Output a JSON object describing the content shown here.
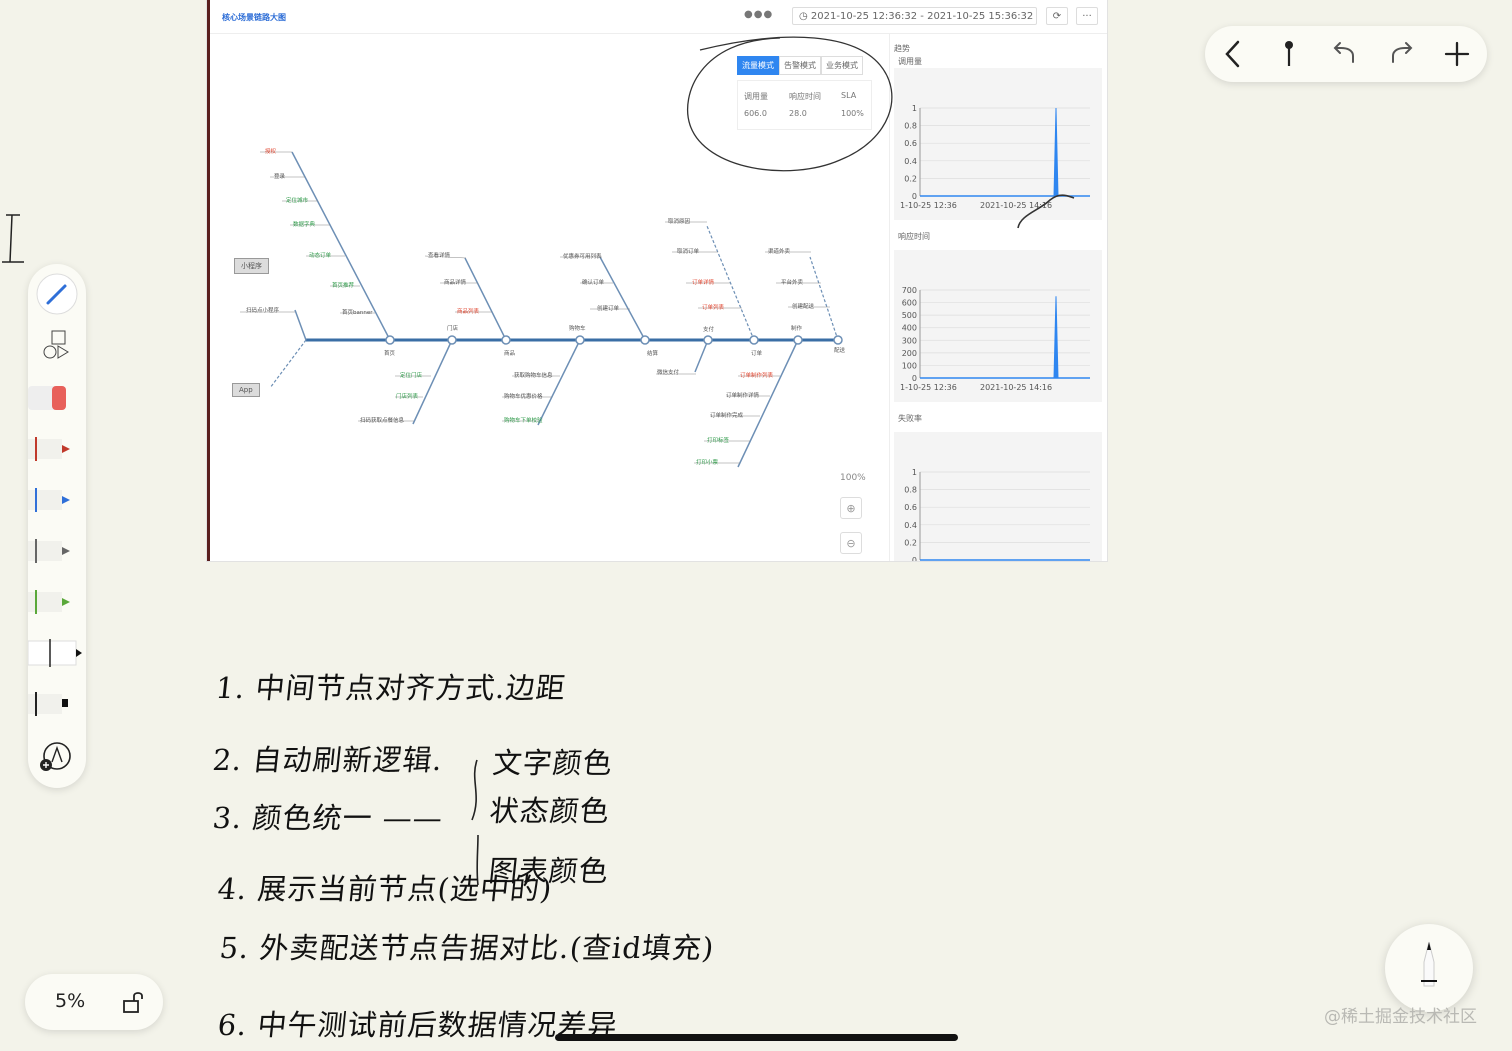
{
  "dashboard": {
    "title": "核心场景链路大图",
    "date_range": "2021-10-25 12:36:32 - 2021-10-25 15:36:32",
    "refresh_icon": "refresh-icon",
    "more_icon": "more-icon",
    "modes": [
      "流量模式",
      "告警模式",
      "业务模式"
    ],
    "active_mode": "流量模式",
    "metrics": {
      "headers": [
        "调用量",
        "响应时间",
        "SLA"
      ],
      "values": [
        "606.0",
        "28.0",
        "100%"
      ]
    },
    "entries": [
      "小程序",
      "App"
    ],
    "spine_nodes": [
      "首页",
      "门店",
      "商品",
      "购物车",
      "结算",
      "支付",
      "订单",
      "制作",
      "配送"
    ],
    "upper_branches": [
      {
        "node": "首页",
        "items": [
          {
            "text": "授权",
            "color": "red"
          },
          {
            "text": "登录",
            "color": "gray"
          },
          {
            "text": "定位城市",
            "color": "green"
          },
          {
            "text": "数据字典",
            "color": "green"
          },
          {
            "text": "动态订单",
            "color": "green"
          },
          {
            "text": "首页推荐",
            "color": "green"
          },
          {
            "text": "首页banner",
            "color": "gray"
          }
        ]
      },
      {
        "node": "商品",
        "items": [
          {
            "text": "查看详情",
            "color": "gray"
          },
          {
            "text": "商品详情",
            "color": "gray"
          },
          {
            "text": "商品列表",
            "color": "red"
          }
        ]
      },
      {
        "node": "结算",
        "items": [
          {
            "text": "优惠券可用列表",
            "color": "gray"
          },
          {
            "text": "确认订单",
            "color": "gray"
          },
          {
            "text": "创建订单",
            "color": "gray"
          }
        ]
      },
      {
        "node": "订单",
        "items": [
          {
            "text": "取消原因",
            "color": "gray"
          },
          {
            "text": "取消订单",
            "color": "gray"
          },
          {
            "text": "订单详情",
            "color": "red"
          },
          {
            "text": "订单列表",
            "color": "red"
          }
        ]
      },
      {
        "node": "配送",
        "items": [
          {
            "text": "渠道外卖",
            "color": "gray"
          },
          {
            "text": "平台外卖",
            "color": "gray"
          },
          {
            "text": "创建配送",
            "color": "gray"
          }
        ]
      }
    ],
    "lower_branches": [
      {
        "node": "门店",
        "items": [
          {
            "text": "定位门店",
            "color": "green"
          },
          {
            "text": "门店列表",
            "color": "green"
          },
          {
            "text": "扫码获取点餐信息",
            "color": "gray"
          }
        ]
      },
      {
        "node": "购物车",
        "items": [
          {
            "text": "获取购物车信息",
            "color": "gray"
          },
          {
            "text": "购物车优惠价格",
            "color": "gray"
          },
          {
            "text": "购物车下单校验",
            "color": "green"
          }
        ]
      },
      {
        "node": "支付",
        "items": [
          {
            "text": "微信支付",
            "color": "gray"
          }
        ]
      },
      {
        "node": "制作",
        "items": [
          {
            "text": "订单制作列表",
            "color": "red"
          },
          {
            "text": "订单制作详情",
            "color": "gray"
          },
          {
            "text": "订单制作完成",
            "color": "gray"
          },
          {
            "text": "打印标签",
            "color": "green"
          },
          {
            "text": "打印小票",
            "color": "green"
          }
        ]
      }
    ],
    "entry_branch_label": "扫码点小程序",
    "zoom": "100%",
    "side": {
      "section": "趋势",
      "charts": [
        {
          "label": "调用量",
          "yticks": [
            "1",
            "0.8",
            "0.6",
            "0.4",
            "0.2",
            "0"
          ],
          "xticks": [
            "1-10-25 12:36",
            "2021-10-25 14:16"
          ],
          "spike": true,
          "spike_value": 1
        },
        {
          "label": "响应时间",
          "yticks": [
            "700",
            "600",
            "500",
            "400",
            "300",
            "200",
            "100",
            "0"
          ],
          "xticks": [
            "1-10-25 12:36",
            "2021-10-25 14:16"
          ],
          "spike": true,
          "spike_value": 650
        },
        {
          "label": "失败率",
          "yticks": [
            "1",
            "0.8",
            "0.6",
            "0.4",
            "0.2",
            "0"
          ],
          "xticks": [
            "1-10-25 12:36",
            "2021-10-25 14:16"
          ],
          "spike": false,
          "spike_value": 0
        }
      ]
    }
  },
  "toolbar": {
    "back_icon": "chevron-left-icon",
    "pin_icon": "pin-icon",
    "undo_icon": "undo-icon",
    "redo_icon": "redo-icon",
    "add_icon": "plus-icon"
  },
  "tools": [
    "pencil-tool",
    "shapes-tool",
    "eraser-tool",
    "red-pen",
    "blue-pen",
    "black-pen",
    "green-pen",
    "highlighter",
    "marker",
    "add-tool"
  ],
  "zoom_level": "5%",
  "lock_icon": "lock-icon",
  "watermark": "@稀土掘金技术社区",
  "notes": {
    "n1": "1. 中间节点对齐方式.边距",
    "n2": "2. 自动刷新逻辑.",
    "n3": "3. 颜色统一 ——",
    "n4": "4. 展示当前节点(选中的)",
    "n5": "5. 外卖配送节点告据对比.(查id填充)",
    "n6": "6. 中午测试前后数据情况差异",
    "b1": "文字颜色",
    "b2": "状态颜色",
    "b3": "图表颜色",
    "margin_mark": "2"
  },
  "colors": {
    "accent": "#2f86f0",
    "spine": "#3a6ea5",
    "red": "#e0452f",
    "green": "#2f9a4a",
    "paper": "#f3f3ea"
  }
}
